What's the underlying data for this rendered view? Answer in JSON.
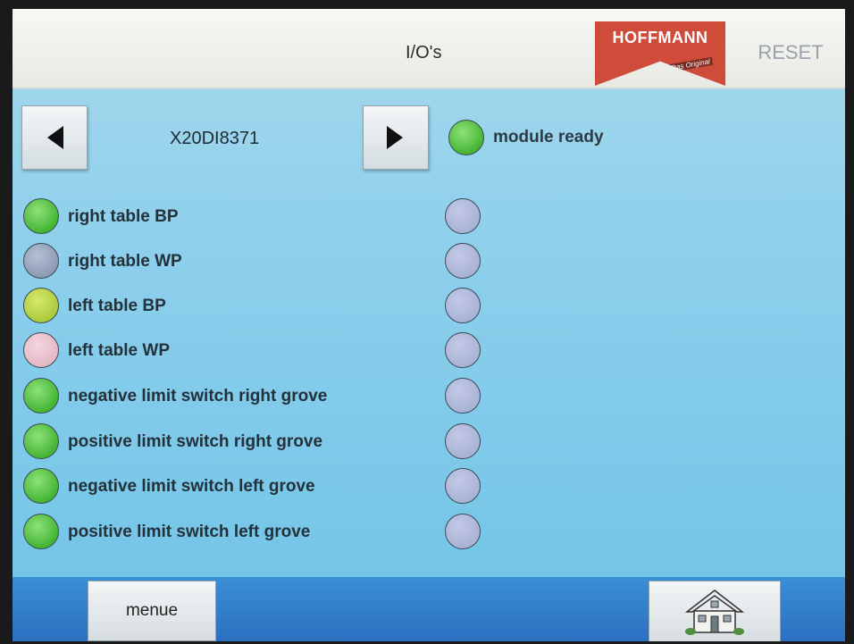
{
  "header": {
    "title": "I/O's",
    "logo_text": "HOFFMANN",
    "logo_tagline": "Das Original",
    "reset_label": "RESET"
  },
  "module": {
    "name": "X20DI8371",
    "prev_icon": "triangle-left-icon",
    "next_icon": "triangle-right-icon",
    "status_label": "module ready",
    "status_color": "green"
  },
  "inputs": [
    {
      "label": "right table BP",
      "state": "green"
    },
    {
      "label": "right table WP",
      "state": "gray"
    },
    {
      "label": "left table BP",
      "state": "yellowgreen"
    },
    {
      "label": "left table WP",
      "state": "pink"
    },
    {
      "label": "negative limit switch right grove",
      "state": "green"
    },
    {
      "label": "positive limit switch right grove",
      "state": "green"
    },
    {
      "label": "negative limit switch left grove",
      "state": "green"
    },
    {
      "label": "positive limit switch left grove",
      "state": "green"
    }
  ],
  "unlabeled_leds": [
    "lavender",
    "lavender",
    "lavender",
    "lavender",
    "lavender",
    "lavender",
    "lavender",
    "lavender"
  ],
  "footer": {
    "menu_label": "menue",
    "home_icon": "house-icon"
  },
  "colors": {
    "background": "#7ec8e8",
    "header": "#f2f2ee",
    "footer": "#2f78c8",
    "logo": "#cf4b3a",
    "led_green": "#45b533"
  }
}
